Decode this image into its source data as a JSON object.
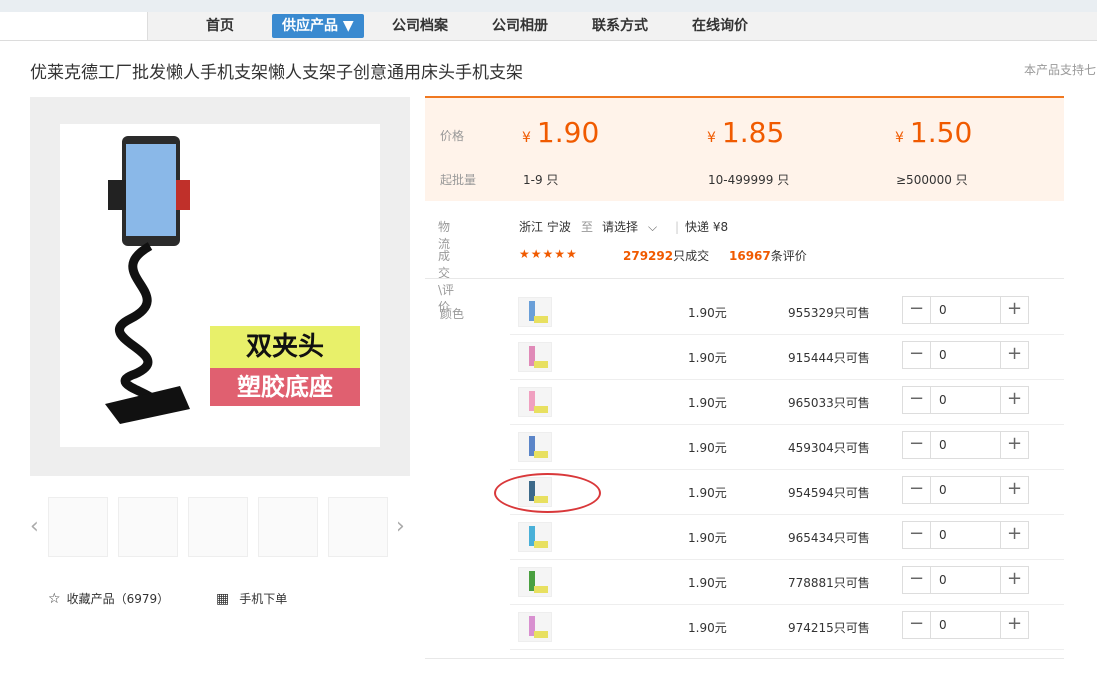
{
  "nav": {
    "items": [
      "首页",
      "供应产品 ▼",
      "公司档案",
      "公司相册",
      "联系方式",
      "在线询价"
    ]
  },
  "product": {
    "title": "优莱克德工厂批发懒人手机支架懒人支架子创意通用床头手机支架",
    "support_text": "本产品支持七",
    "badge_line1": "双夹头",
    "badge_line2": "塑胶底座"
  },
  "gallery": {
    "prev": "‹",
    "next": "›",
    "favorite_label": "收藏产品（6979）",
    "mobile_label": "手机下单"
  },
  "pricing": {
    "price_label": "价格",
    "qty_label": "起批量",
    "currency": "¥",
    "tiers": [
      {
        "price": "1.90",
        "qty": "1-9 只"
      },
      {
        "price": "1.85",
        "qty": "10-499999 只"
      },
      {
        "price": "1.50",
        "qty": "≥500000 只"
      }
    ]
  },
  "logistics": {
    "label": "物流",
    "from": "浙江 宁波",
    "to_word": "至",
    "select": "请选择",
    "express": "快递 ¥8"
  },
  "deals": {
    "label": "成交\\评价",
    "stars": "★★★★★",
    "sold_count": "279292",
    "sold_suffix": "只成交",
    "review_count": "16967",
    "review_suffix": "条评价",
    "rating": 4.5
  },
  "sku": {
    "label": "颜色",
    "rows": [
      {
        "price": "1.90元",
        "stock": "955329只可售",
        "qty": "0"
      },
      {
        "price": "1.90元",
        "stock": "915444只可售",
        "qty": "0"
      },
      {
        "price": "1.90元",
        "stock": "965033只可售",
        "qty": "0"
      },
      {
        "price": "1.90元",
        "stock": "459304只可售",
        "qty": "0"
      },
      {
        "price": "1.90元",
        "stock": "954594只可售",
        "qty": "0"
      },
      {
        "price": "1.90元",
        "stock": "965434只可售",
        "qty": "0"
      },
      {
        "price": "1.90元",
        "stock": "778881只可售",
        "qty": "0"
      },
      {
        "price": "1.90元",
        "stock": "974215只可售",
        "qty": "0"
      }
    ],
    "minus": "−",
    "plus": "+"
  },
  "colors": {
    "accent": "#f05a00",
    "nav_active": "#3a8ad0",
    "annotation": "#d9383a"
  }
}
